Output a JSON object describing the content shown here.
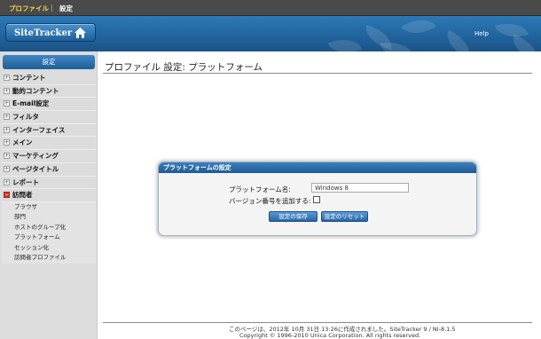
{
  "topbar": {
    "profile": "プロファイル",
    "separator": "|",
    "settings": "設定"
  },
  "banner": {
    "logo": "SiteTracker",
    "help": "Help"
  },
  "sidebar": {
    "header": "設定",
    "items": [
      {
        "label": "コンテント",
        "expander": "+"
      },
      {
        "label": "動的コンテント",
        "expander": "+"
      },
      {
        "label": "E-mail設定",
        "expander": "+"
      },
      {
        "label": "フィルタ",
        "expander": "+"
      },
      {
        "label": "インターフェイス",
        "expander": "+"
      },
      {
        "label": "メイン",
        "expander": "+"
      },
      {
        "label": "マーケティング",
        "expander": "+"
      },
      {
        "label": "ページタイトル",
        "expander": "+"
      },
      {
        "label": "レポート",
        "expander": "+"
      },
      {
        "label": "訪問者",
        "expander": "−"
      }
    ],
    "subitems": [
      "ブラウザ",
      "部門",
      "ホストのグループ化",
      "プラットフォーム",
      "セッション化",
      "訪問者プロファイル"
    ]
  },
  "main": {
    "title": "プロファイル 設定: プラットフォーム",
    "panel": {
      "header": "プラットフォームの設定",
      "name_label": "プラットフォーム名:",
      "name_value": "Windows 8",
      "version_label": "バージョン番号を追加する:",
      "save_button": "設定の保存",
      "reset_button": "設定のリセット"
    },
    "footer": {
      "line1": "このページは、2012年 10月 31日 13:26に作成されました。SiteTracker 9 / NI-8.1.5",
      "line2": "Copyright © 1996-2010 Unica Corporation. All rights reserved."
    }
  },
  "colors": {
    "banner": "#1f5f97",
    "accent": "#2b79b8",
    "active_marker": "#cf3a2a",
    "top_link": "#f5d64a"
  }
}
